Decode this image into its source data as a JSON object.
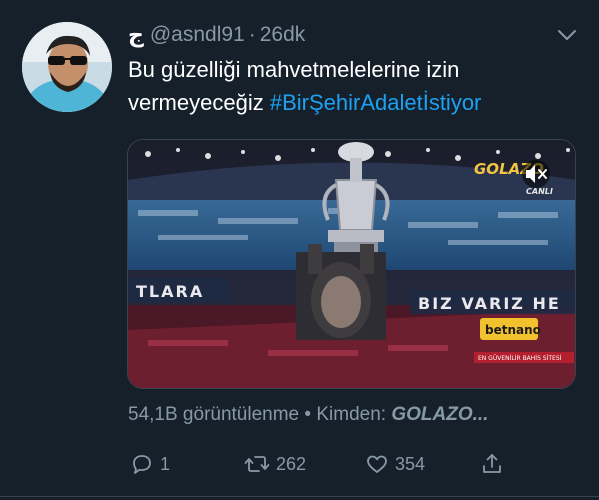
{
  "user": {
    "display_name": "ج",
    "handle": "@asndl91",
    "separator": "·",
    "timestamp": "26dk"
  },
  "tweet": {
    "text": "Bu güzelliği mahvetmelelerine izin vermeyeceğiz",
    "hashtag": "#BirŞehirAdaletİstiyor"
  },
  "media": {
    "broadcaster_logo_line1": "GOLAZO",
    "broadcaster_logo_line2": "CANLI",
    "banner_left": "TLARA",
    "banner_right": "BIZ VARIZ HE",
    "sponsor": "betnano",
    "ticker": "EN GÜVENİLİR BAHİS SİTESİ"
  },
  "stats": {
    "views": "54,1B görüntülenme",
    "bullet": "•",
    "source_label": "Kimden:",
    "source_name": "GOLAZO..."
  },
  "actions": {
    "reply_count": "1",
    "retweet_count": "262",
    "like_count": "354"
  },
  "colors": {
    "background": "#15202b",
    "text": "#ffffff",
    "muted": "#8899a6",
    "link": "#1da1f2"
  }
}
